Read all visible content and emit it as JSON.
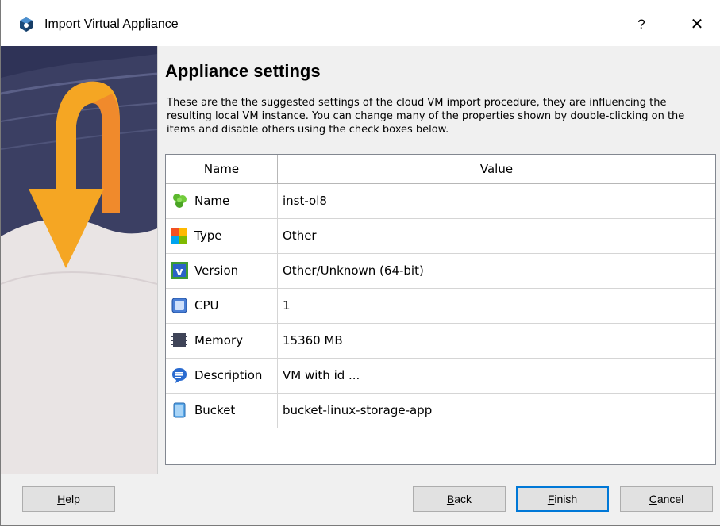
{
  "window": {
    "title": "Import Virtual Appliance",
    "help_glyph": "?",
    "close_glyph": "✕"
  },
  "page": {
    "heading": "Appliance settings",
    "description": "These are the the suggested settings of the cloud VM import procedure, they are influencing the resulting local VM instance. You can change many of the properties shown by double-clicking on the items and disable others using the check boxes below."
  },
  "table": {
    "headers": {
      "name": "Name",
      "value": "Value"
    },
    "rows": [
      {
        "icon": "name-icon",
        "label": "Name",
        "value": "inst-ol8"
      },
      {
        "icon": "os-type-icon",
        "label": "Type",
        "value": "Other"
      },
      {
        "icon": "version-icon",
        "label": "Version",
        "value": "Other/Unknown (64-bit)"
      },
      {
        "icon": "cpu-icon",
        "label": "CPU",
        "value": "1"
      },
      {
        "icon": "memory-icon",
        "label": "Memory",
        "value": "15360 MB"
      },
      {
        "icon": "description-icon",
        "label": "Description",
        "value": "VM with id ..."
      },
      {
        "icon": "bucket-icon",
        "label": "Bucket",
        "value": "bucket-linux-storage-app"
      }
    ]
  },
  "buttons": {
    "help_key": "H",
    "help_rest": "elp",
    "back_key": "B",
    "back_rest": "ack",
    "finish_key": "F",
    "finish_rest": "inish",
    "cancel_key": "C",
    "cancel_rest": "ancel"
  },
  "colors": {
    "accent": "#0078d7",
    "arrow": "#f5a623",
    "art_sky": "#3b3f63",
    "art_ground": "#e9e4e4"
  }
}
